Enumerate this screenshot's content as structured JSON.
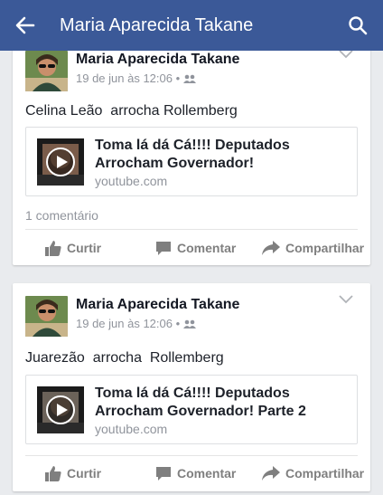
{
  "topbar": {
    "title": "Maria Aparecida Takane",
    "back_icon": "arrow-left-icon",
    "search_icon": "search-icon"
  },
  "posts": [
    {
      "author": "Maria Aparecida Takane",
      "timestamp": "19 de jun às 12:06 •",
      "text": "Celina Leão  arrocha Rollemberg",
      "link": {
        "title": "Toma lá dá Cá!!!! Deputados Arrocham Governador!",
        "domain": "youtube.com"
      },
      "comments": "1 comentário",
      "actions": {
        "like": "Curtir",
        "comment": "Comentar",
        "share": "Compartilhar"
      }
    },
    {
      "author": "Maria Aparecida Takane",
      "timestamp": "19 de jun às 12:06 •",
      "text": "Juarezão  arrocha  Rollemberg",
      "link": {
        "title": "Toma lá dá Cá!!!! Deputados Arrocham Governador! Parte 2",
        "domain": "youtube.com"
      },
      "actions": {
        "like": "Curtir",
        "comment": "Comentar",
        "share": "Compartilhar"
      }
    }
  ],
  "colors": {
    "brand": "#3b5998",
    "text": "#1d2129",
    "muted": "#90949c",
    "action": "#7f7f7f"
  }
}
